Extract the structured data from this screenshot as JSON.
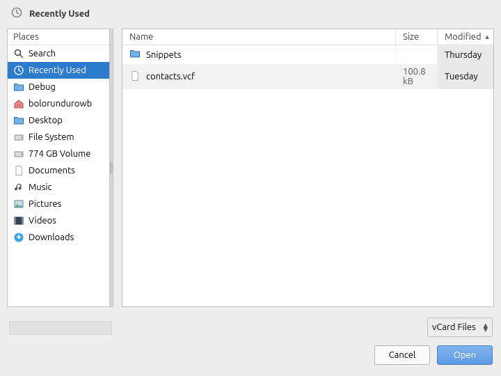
{
  "title": "Recently Used",
  "sidebar": {
    "header": "Places",
    "items": [
      {
        "icon": "search-icon",
        "label": "Search"
      },
      {
        "icon": "clock-icon",
        "label": "Recently Used",
        "selected": true
      },
      {
        "icon": "folder-icon",
        "label": "Debug"
      },
      {
        "icon": "home-icon",
        "label": "bolorundurowb"
      },
      {
        "icon": "folder-icon",
        "label": "Desktop"
      },
      {
        "icon": "drive-icon",
        "label": "File System"
      },
      {
        "icon": "drive-icon",
        "label": "774 GB Volume"
      },
      {
        "icon": "file-icon",
        "label": "Documents"
      },
      {
        "icon": "music-icon",
        "label": "Music"
      },
      {
        "icon": "pictures-icon",
        "label": "Pictures"
      },
      {
        "icon": "video-icon",
        "label": "Videos"
      },
      {
        "icon": "download-icon",
        "label": "Downloads"
      }
    ]
  },
  "list": {
    "columns": {
      "name": "Name",
      "size": "Size",
      "modified": "Modified"
    },
    "sort_indicator": "▲",
    "rows": [
      {
        "icon": "folder-icon",
        "name": "Snippets",
        "size": "",
        "modified": "Thursday",
        "selected": false
      },
      {
        "icon": "file-icon",
        "name": "contacts.vcf",
        "size": "100.8 kB",
        "modified": "Tuesday",
        "selected": true
      }
    ]
  },
  "filter": {
    "label": "vCard Files"
  },
  "buttons": {
    "cancel": "Cancel",
    "open": "Open"
  }
}
